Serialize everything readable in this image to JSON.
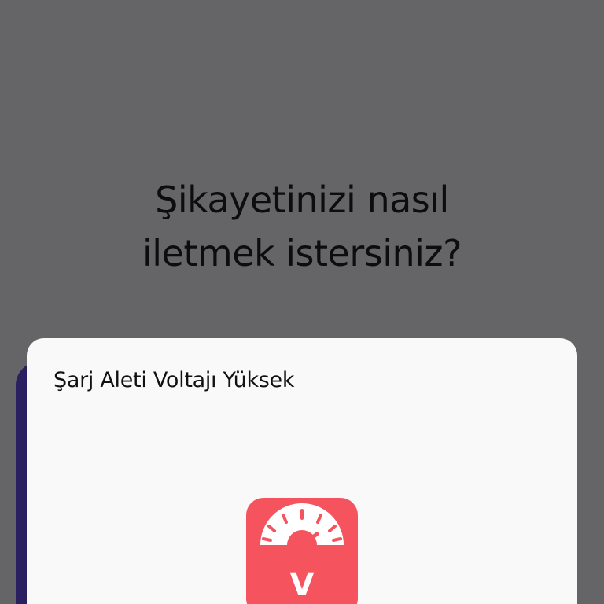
{
  "page": {
    "question_line1": "Şikayetinizi nasıl",
    "question_line2": "iletmek istersiniz?"
  },
  "sheet": {
    "title": "Şarj Aleti Voltajı Yüksek",
    "icon": "voltmeter-icon",
    "icon_label": "V",
    "accent_color": "#f5545f"
  },
  "colors": {
    "overlay": "#656567",
    "sheet_background": "#f9f9f9",
    "background_card": "#2a2060"
  }
}
